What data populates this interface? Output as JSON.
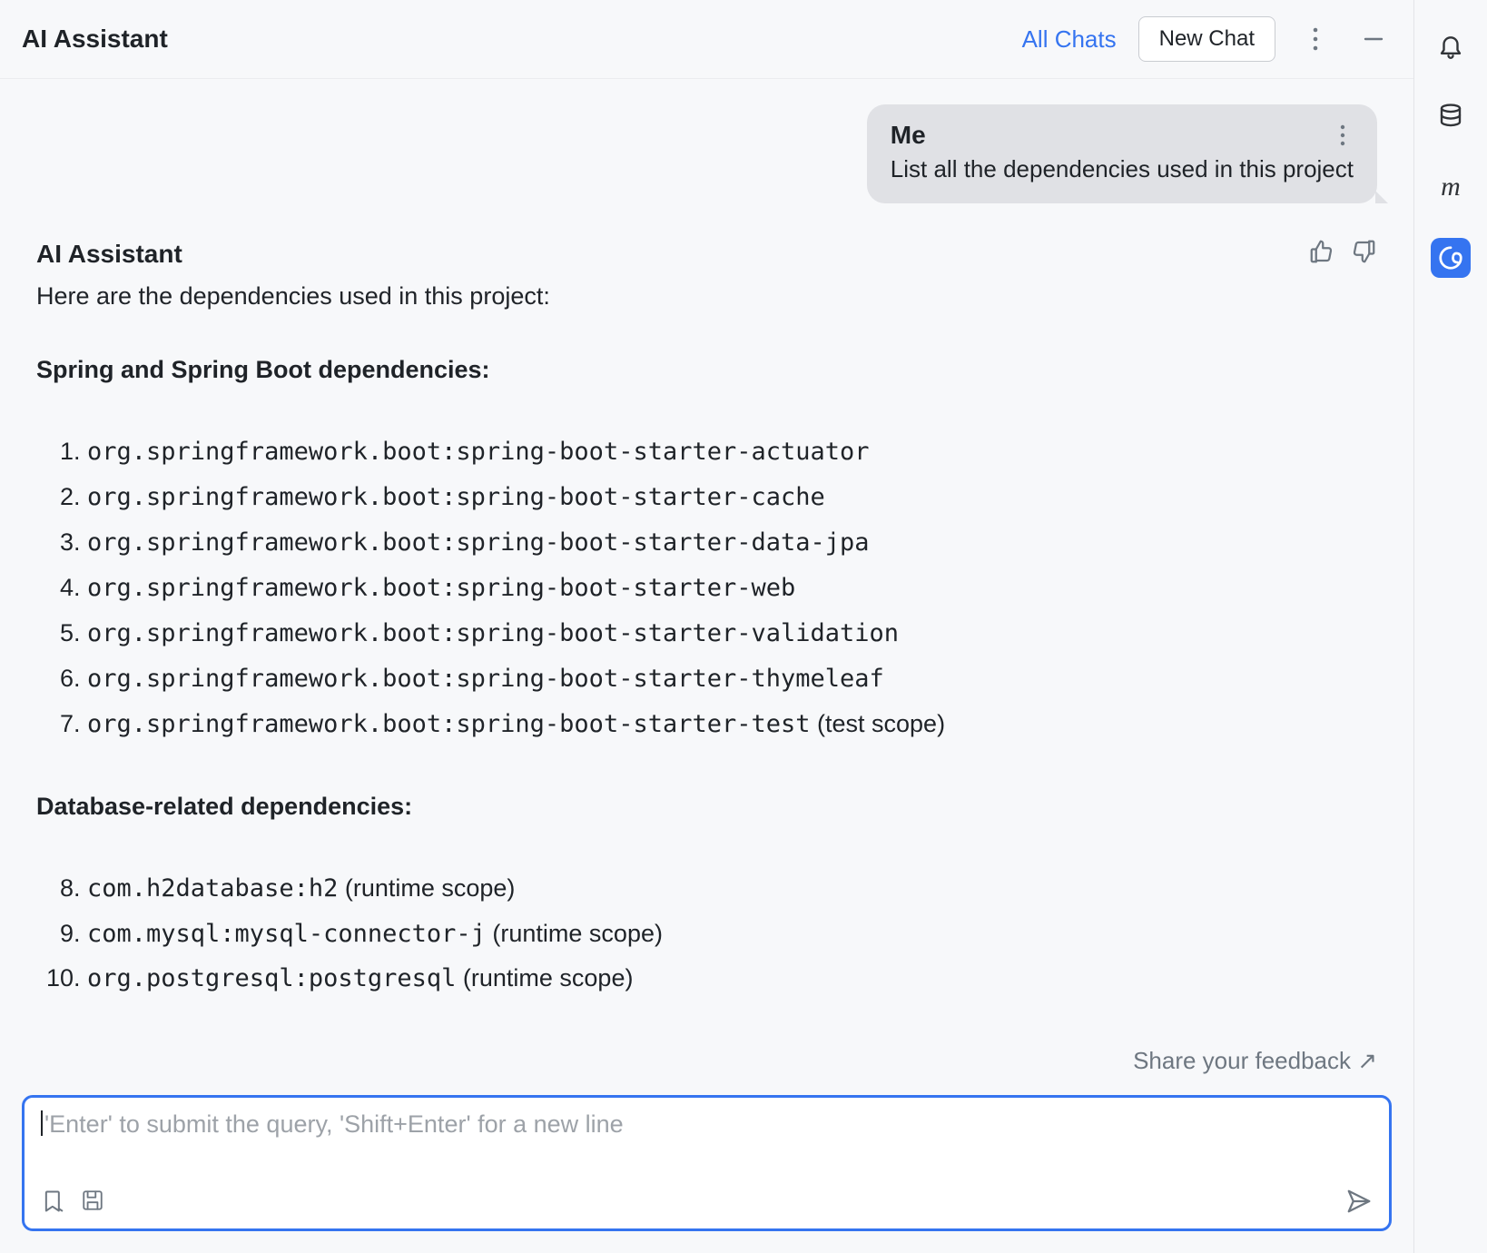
{
  "header": {
    "title": "AI Assistant",
    "all_chats": "All Chats",
    "new_chat": "New Chat"
  },
  "conversation": {
    "user": {
      "name": "Me",
      "message": "List all the dependencies used in this project"
    },
    "assistant": {
      "name": "AI Assistant",
      "intro": "Here are the dependencies used in this project:",
      "sections": [
        {
          "heading": "Spring and Spring Boot dependencies:",
          "start": 1,
          "items": [
            {
              "artifact": "org.springframework.boot:spring-boot-starter-actuator",
              "note": ""
            },
            {
              "artifact": "org.springframework.boot:spring-boot-starter-cache",
              "note": ""
            },
            {
              "artifact": "org.springframework.boot:spring-boot-starter-data-jpa",
              "note": ""
            },
            {
              "artifact": "org.springframework.boot:spring-boot-starter-web",
              "note": ""
            },
            {
              "artifact": "org.springframework.boot:spring-boot-starter-validation",
              "note": ""
            },
            {
              "artifact": "org.springframework.boot:spring-boot-starter-thymeleaf",
              "note": ""
            },
            {
              "artifact": "org.springframework.boot:spring-boot-starter-test",
              "note": " (test scope)"
            }
          ]
        },
        {
          "heading": "Database-related dependencies:",
          "start": 8,
          "items": [
            {
              "artifact": "com.h2database:h2",
              "note": " (runtime scope)"
            },
            {
              "artifact": "com.mysql:mysql-connector-j",
              "note": " (runtime scope)"
            },
            {
              "artifact": "org.postgresql:postgresql",
              "note": " (runtime scope)"
            }
          ]
        }
      ]
    }
  },
  "footer": {
    "share_feedback": "Share your feedback ↗"
  },
  "input": {
    "placeholder": "'Enter' to submit the query, 'Shift+Enter' for a new line"
  }
}
